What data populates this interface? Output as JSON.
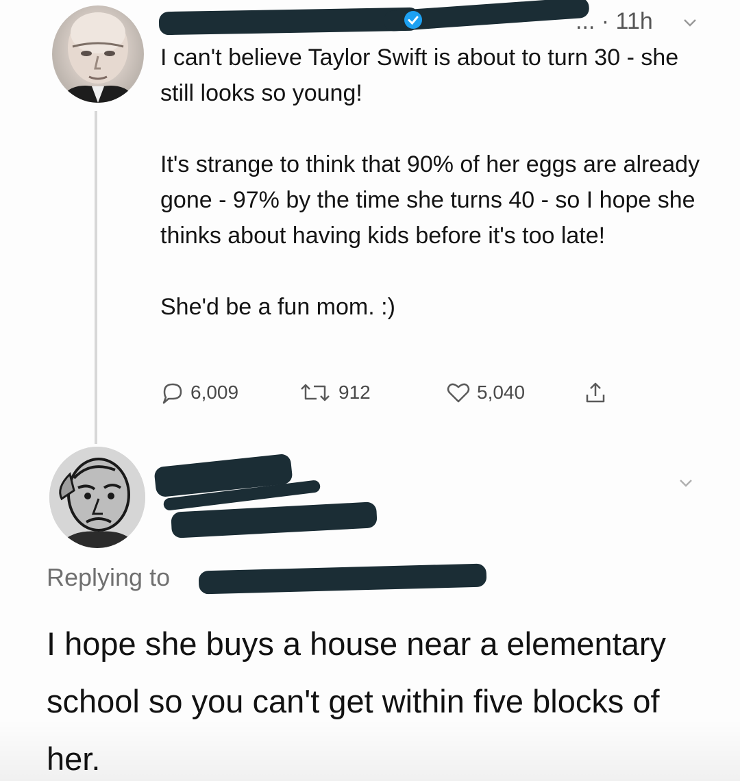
{
  "tweet": {
    "meta": "...  · 11h",
    "paragraphs": [
      "I can't believe Taylor Swift is about to turn 30 - she still looks so young!",
      "It's strange to think that 90% of her eggs are already gone - 97% by the time she turns 40 - so I hope she thinks about having kids before it's too late!",
      "She'd be a fun mom. :)"
    ],
    "stats": {
      "replies": "6,009",
      "retweets": "912",
      "likes": "5,040"
    },
    "icons": [
      "verified-badge-icon",
      "chevron-down-icon",
      "reply-icon",
      "retweet-icon",
      "like-icon",
      "share-icon"
    ]
  },
  "reply": {
    "replying_label": "Replying to",
    "text": "I hope she buys a house near a elementary school so you can't get within five blocks of her.",
    "icons": [
      "chevron-down-icon"
    ]
  },
  "colors": {
    "redaction": "#1b2d35",
    "verified": "#1da1f2",
    "muted_text": "#707070",
    "thread_line": "#d7d7d7"
  }
}
